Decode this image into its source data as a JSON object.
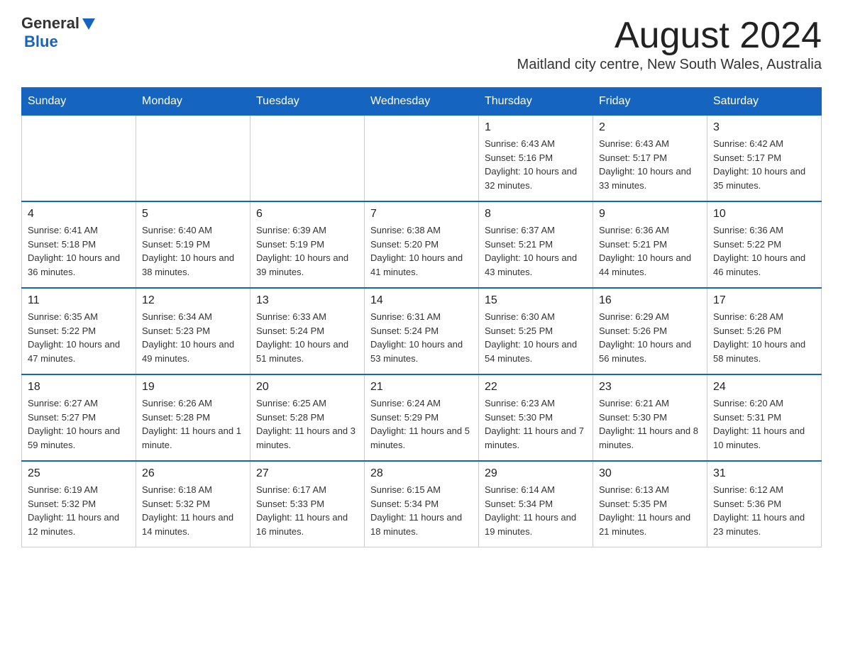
{
  "header": {
    "logo_general": "General",
    "logo_blue": "Blue",
    "month_title": "August 2024",
    "location": "Maitland city centre, New South Wales, Australia"
  },
  "days_of_week": [
    "Sunday",
    "Monday",
    "Tuesday",
    "Wednesday",
    "Thursday",
    "Friday",
    "Saturday"
  ],
  "weeks": [
    [
      {
        "day": "",
        "info": ""
      },
      {
        "day": "",
        "info": ""
      },
      {
        "day": "",
        "info": ""
      },
      {
        "day": "",
        "info": ""
      },
      {
        "day": "1",
        "info": "Sunrise: 6:43 AM\nSunset: 5:16 PM\nDaylight: 10 hours and 32 minutes."
      },
      {
        "day": "2",
        "info": "Sunrise: 6:43 AM\nSunset: 5:17 PM\nDaylight: 10 hours and 33 minutes."
      },
      {
        "day": "3",
        "info": "Sunrise: 6:42 AM\nSunset: 5:17 PM\nDaylight: 10 hours and 35 minutes."
      }
    ],
    [
      {
        "day": "4",
        "info": "Sunrise: 6:41 AM\nSunset: 5:18 PM\nDaylight: 10 hours and 36 minutes."
      },
      {
        "day": "5",
        "info": "Sunrise: 6:40 AM\nSunset: 5:19 PM\nDaylight: 10 hours and 38 minutes."
      },
      {
        "day": "6",
        "info": "Sunrise: 6:39 AM\nSunset: 5:19 PM\nDaylight: 10 hours and 39 minutes."
      },
      {
        "day": "7",
        "info": "Sunrise: 6:38 AM\nSunset: 5:20 PM\nDaylight: 10 hours and 41 minutes."
      },
      {
        "day": "8",
        "info": "Sunrise: 6:37 AM\nSunset: 5:21 PM\nDaylight: 10 hours and 43 minutes."
      },
      {
        "day": "9",
        "info": "Sunrise: 6:36 AM\nSunset: 5:21 PM\nDaylight: 10 hours and 44 minutes."
      },
      {
        "day": "10",
        "info": "Sunrise: 6:36 AM\nSunset: 5:22 PM\nDaylight: 10 hours and 46 minutes."
      }
    ],
    [
      {
        "day": "11",
        "info": "Sunrise: 6:35 AM\nSunset: 5:22 PM\nDaylight: 10 hours and 47 minutes."
      },
      {
        "day": "12",
        "info": "Sunrise: 6:34 AM\nSunset: 5:23 PM\nDaylight: 10 hours and 49 minutes."
      },
      {
        "day": "13",
        "info": "Sunrise: 6:33 AM\nSunset: 5:24 PM\nDaylight: 10 hours and 51 minutes."
      },
      {
        "day": "14",
        "info": "Sunrise: 6:31 AM\nSunset: 5:24 PM\nDaylight: 10 hours and 53 minutes."
      },
      {
        "day": "15",
        "info": "Sunrise: 6:30 AM\nSunset: 5:25 PM\nDaylight: 10 hours and 54 minutes."
      },
      {
        "day": "16",
        "info": "Sunrise: 6:29 AM\nSunset: 5:26 PM\nDaylight: 10 hours and 56 minutes."
      },
      {
        "day": "17",
        "info": "Sunrise: 6:28 AM\nSunset: 5:26 PM\nDaylight: 10 hours and 58 minutes."
      }
    ],
    [
      {
        "day": "18",
        "info": "Sunrise: 6:27 AM\nSunset: 5:27 PM\nDaylight: 10 hours and 59 minutes."
      },
      {
        "day": "19",
        "info": "Sunrise: 6:26 AM\nSunset: 5:28 PM\nDaylight: 11 hours and 1 minute."
      },
      {
        "day": "20",
        "info": "Sunrise: 6:25 AM\nSunset: 5:28 PM\nDaylight: 11 hours and 3 minutes."
      },
      {
        "day": "21",
        "info": "Sunrise: 6:24 AM\nSunset: 5:29 PM\nDaylight: 11 hours and 5 minutes."
      },
      {
        "day": "22",
        "info": "Sunrise: 6:23 AM\nSunset: 5:30 PM\nDaylight: 11 hours and 7 minutes."
      },
      {
        "day": "23",
        "info": "Sunrise: 6:21 AM\nSunset: 5:30 PM\nDaylight: 11 hours and 8 minutes."
      },
      {
        "day": "24",
        "info": "Sunrise: 6:20 AM\nSunset: 5:31 PM\nDaylight: 11 hours and 10 minutes."
      }
    ],
    [
      {
        "day": "25",
        "info": "Sunrise: 6:19 AM\nSunset: 5:32 PM\nDaylight: 11 hours and 12 minutes."
      },
      {
        "day": "26",
        "info": "Sunrise: 6:18 AM\nSunset: 5:32 PM\nDaylight: 11 hours and 14 minutes."
      },
      {
        "day": "27",
        "info": "Sunrise: 6:17 AM\nSunset: 5:33 PM\nDaylight: 11 hours and 16 minutes."
      },
      {
        "day": "28",
        "info": "Sunrise: 6:15 AM\nSunset: 5:34 PM\nDaylight: 11 hours and 18 minutes."
      },
      {
        "day": "29",
        "info": "Sunrise: 6:14 AM\nSunset: 5:34 PM\nDaylight: 11 hours and 19 minutes."
      },
      {
        "day": "30",
        "info": "Sunrise: 6:13 AM\nSunset: 5:35 PM\nDaylight: 11 hours and 21 minutes."
      },
      {
        "day": "31",
        "info": "Sunrise: 6:12 AM\nSunset: 5:36 PM\nDaylight: 11 hours and 23 minutes."
      }
    ]
  ]
}
